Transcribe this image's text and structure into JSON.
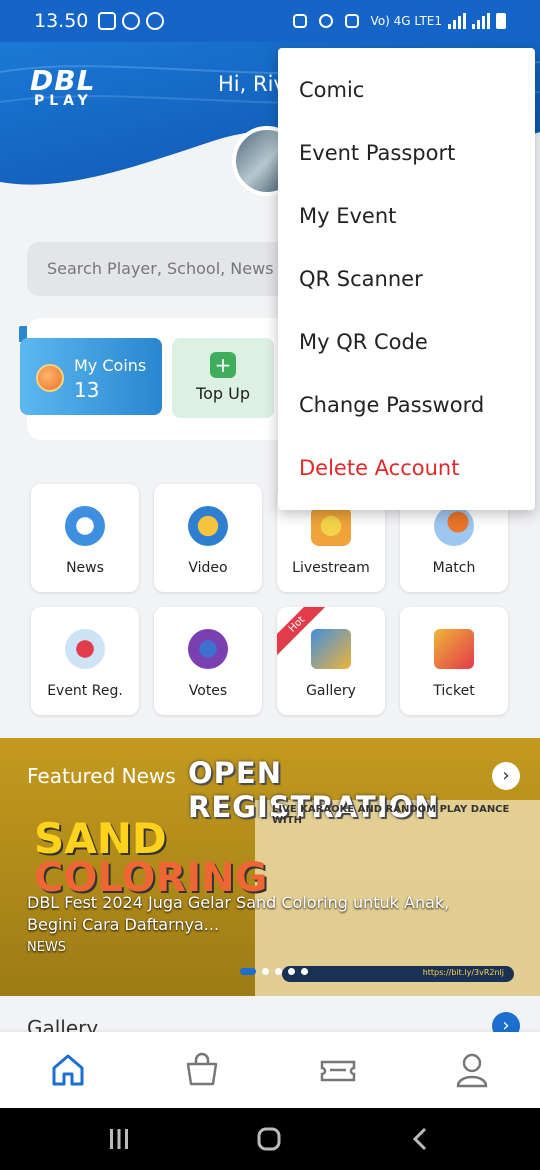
{
  "status_bar": {
    "time": "13.50",
    "network": "Vo) 4G LTE1"
  },
  "header": {
    "logo_top": "DBL",
    "logo_bottom": "PLAY",
    "greeting": "Hi, Riv"
  },
  "search": {
    "placeholder": "Search Player, School, News &"
  },
  "wallet": {
    "coins_label": "My Coins",
    "coins_value": "13",
    "topup_label": "Top Up"
  },
  "menu_grid": [
    {
      "label": "News",
      "icon": "news-icon",
      "color": "#3f8fe0"
    },
    {
      "label": "Video",
      "icon": "video-play-icon",
      "color": "#2f7fd0"
    },
    {
      "label": "Livestream",
      "icon": "livestream-icon",
      "color": "#f0b43a"
    },
    {
      "label": "Match",
      "icon": "basketball-icon",
      "color": "#e9742a"
    },
    {
      "label": "Event Reg.",
      "icon": "whistle-icon",
      "color": "#e23b4a"
    },
    {
      "label": "Votes",
      "icon": "votes-icon",
      "color": "#7a3fb0"
    },
    {
      "label": "Gallery",
      "icon": "gallery-icon",
      "color": "#f0b43a",
      "badge": "Hot"
    },
    {
      "label": "Ticket",
      "icon": "ticket-icon",
      "color": "#e23b4a"
    }
  ],
  "featured": {
    "label": "Featured News",
    "banner_title": "OPEN REGISTRATION",
    "banner_sand": "SAND",
    "banner_coloring": "COLORING",
    "banner_karaoke": "LIVE KARAOKE AND RANDOM PLAY DANCE WITH",
    "headline": "DBL Fest 2024 Juga Gelar Sand Coloring untuk Anak, Begini Cara Daftarnya...",
    "category": "NEWS",
    "link_text": "https://bit.ly/3vR2nlj",
    "dots": 5,
    "active_dot": 0
  },
  "gallery": {
    "label": "Gallery"
  },
  "bottom_nav": [
    "home-icon",
    "shop-icon",
    "ticket-nav-icon",
    "profile-icon"
  ],
  "dropdown": {
    "items": [
      "Comic",
      "Event Passport",
      "My Event",
      "QR Scanner",
      "My QR Code",
      "Change Password"
    ],
    "danger_item": "Delete Account",
    "danger_color": "#e22a2a"
  },
  "colors": {
    "brand": "#1565c8",
    "accent": "#1c6fd1"
  }
}
